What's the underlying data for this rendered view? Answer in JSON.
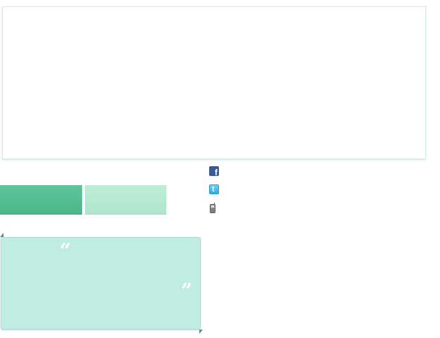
{
  "content_panel": {
    "text": ""
  },
  "tabs": [
    {
      "label": ""
    },
    {
      "label": ""
    }
  ],
  "social": {
    "facebook_glyph": "f",
    "twitter_glyph": "t",
    "icons": [
      "facebook-icon",
      "twitter-icon",
      "mobile-phone-icon"
    ],
    "colors": {
      "facebook": "#3b5998",
      "twitter": "#33a9dd"
    }
  },
  "testimonial": {
    "open_quote": "“",
    "close_quote": "”",
    "text": "",
    "background": "#c1ece1"
  },
  "colors": {
    "accent_primary": "#4bb88a",
    "accent_secondary": "#aee6cc"
  }
}
